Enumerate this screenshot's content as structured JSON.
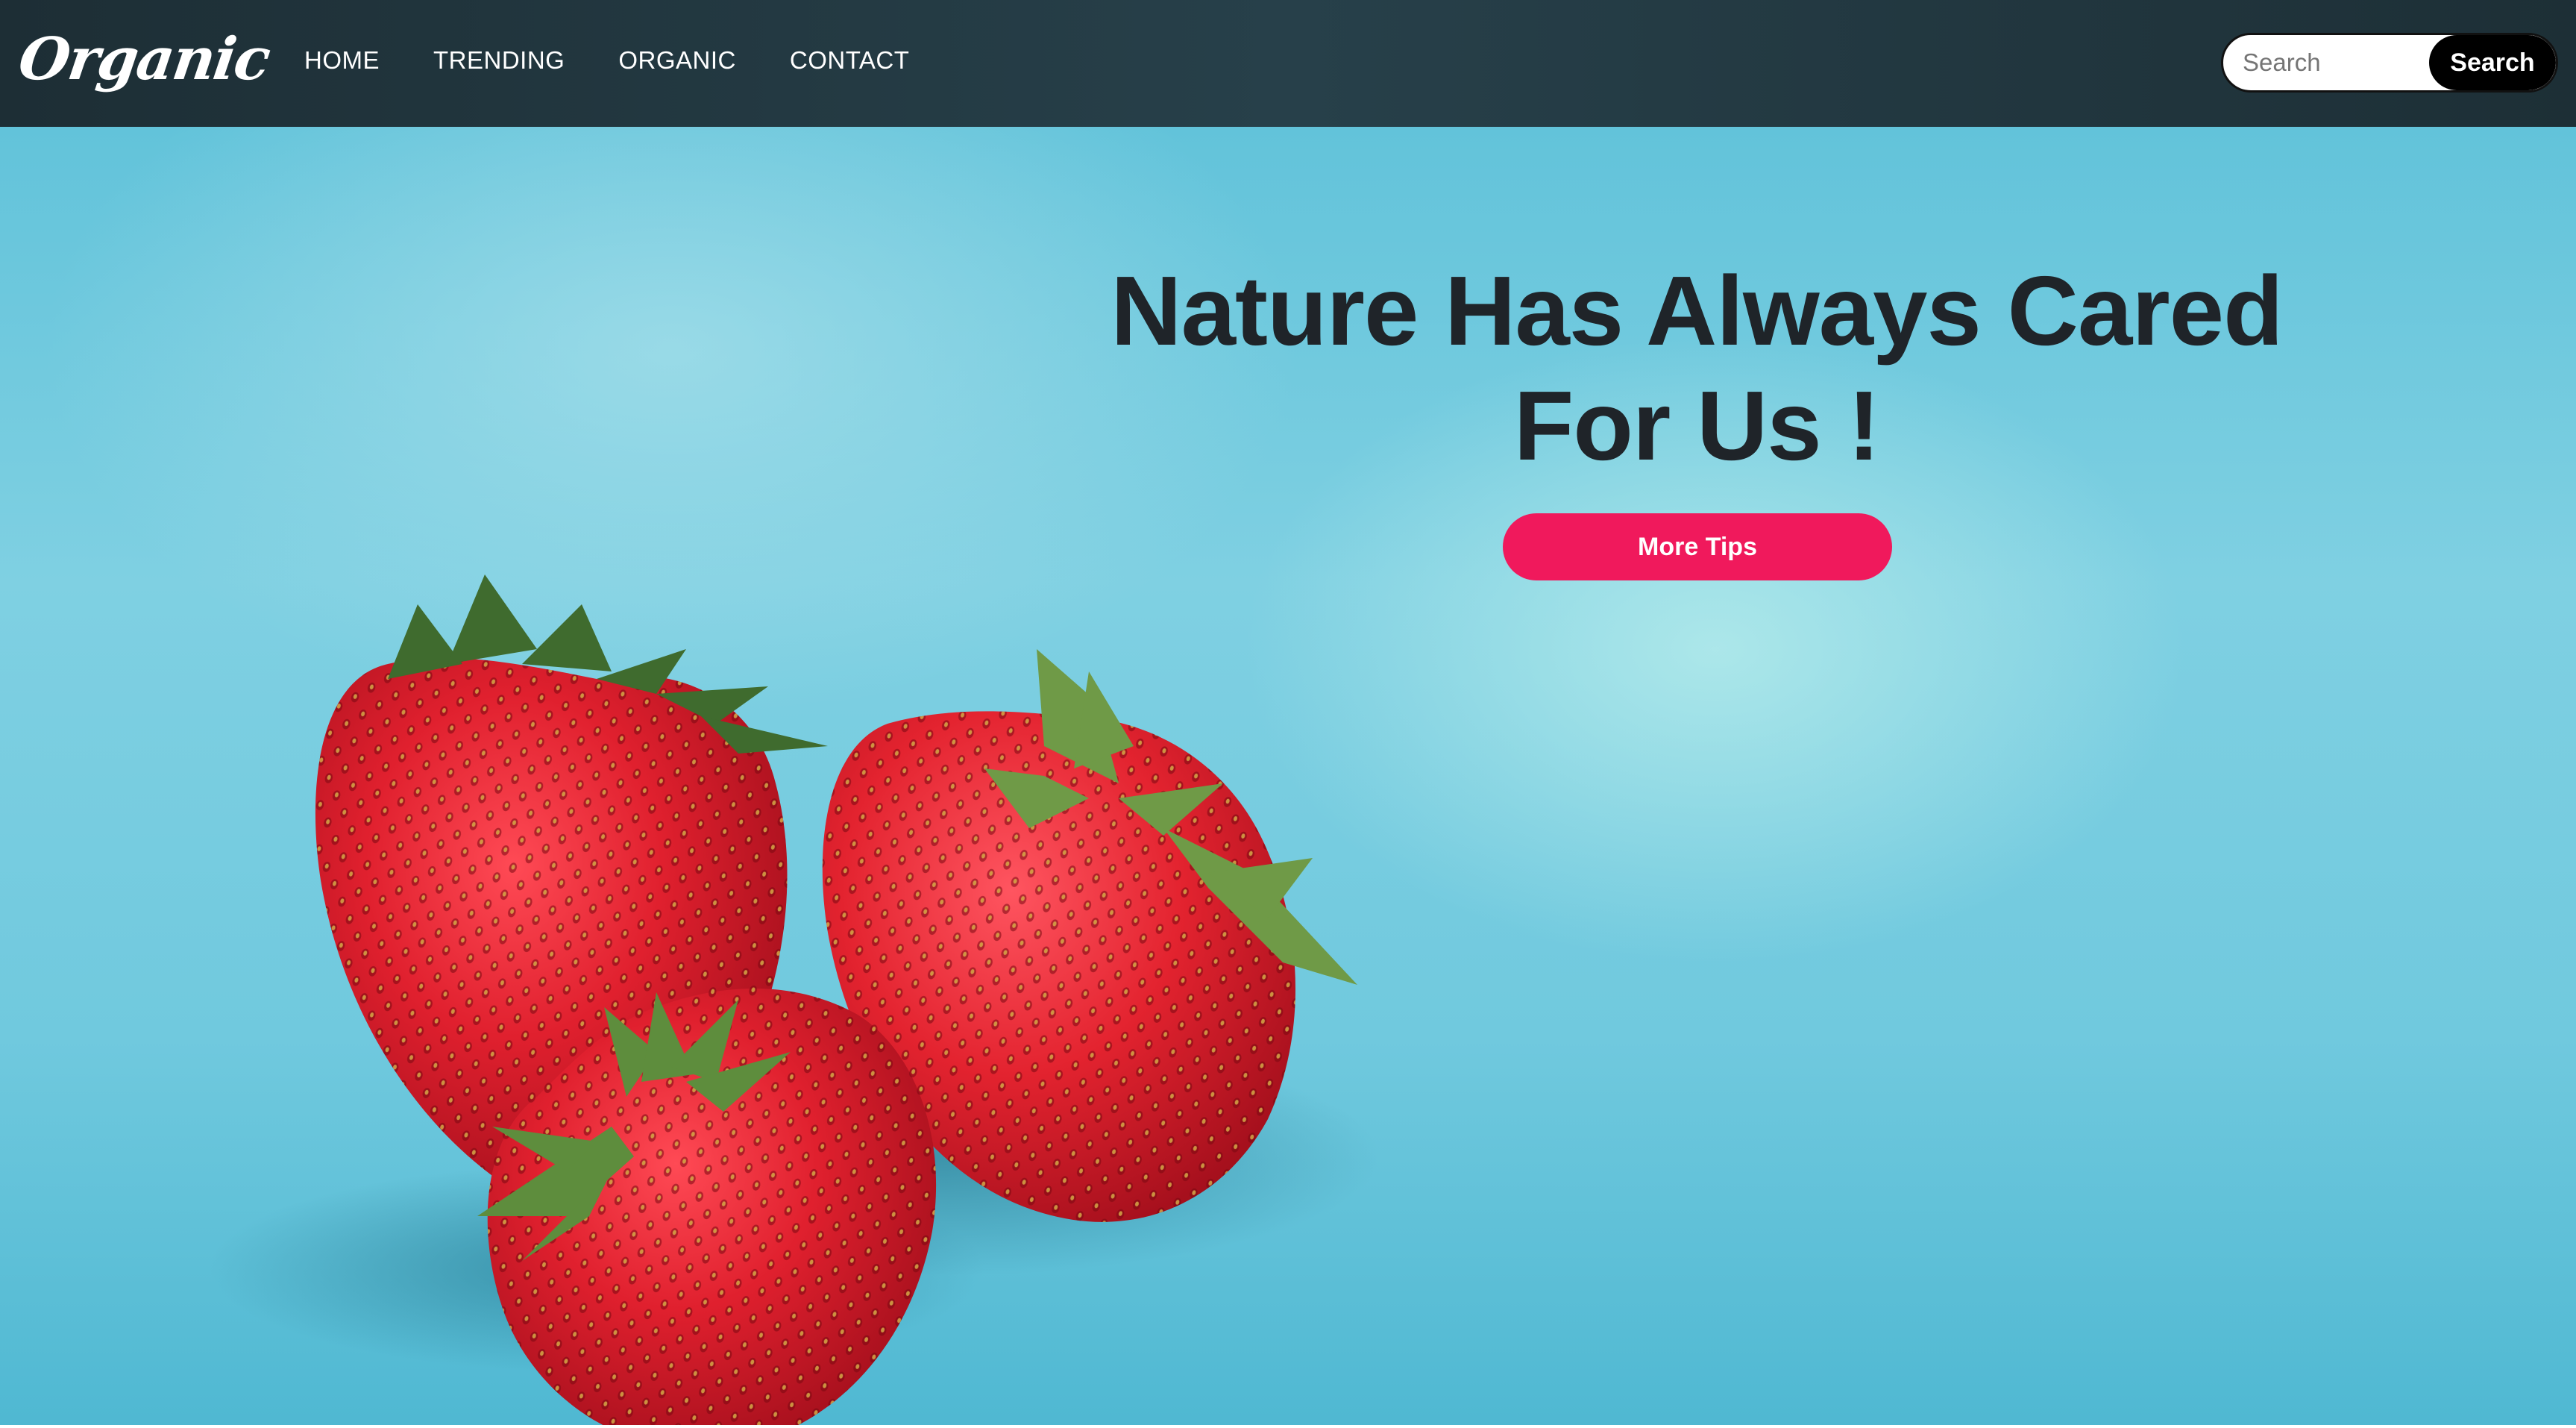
{
  "navbar": {
    "logo": "Organic",
    "links": [
      {
        "label": "HOME"
      },
      {
        "label": "TRENDING"
      },
      {
        "label": "ORGANIC"
      },
      {
        "label": "CONTACT"
      }
    ],
    "search": {
      "placeholder": "Search",
      "value": "",
      "button_label": "Search"
    }
  },
  "hero": {
    "title": "Nature Has Always Cared For Us !",
    "cta_label": "More Tips",
    "image_subject": "three strawberries on blue background"
  },
  "colors": {
    "navbar": "#24373f",
    "hero_bg": "#6cc8de",
    "title": "#1f2429",
    "cta": "#f0195c",
    "search_button": "#000000"
  }
}
